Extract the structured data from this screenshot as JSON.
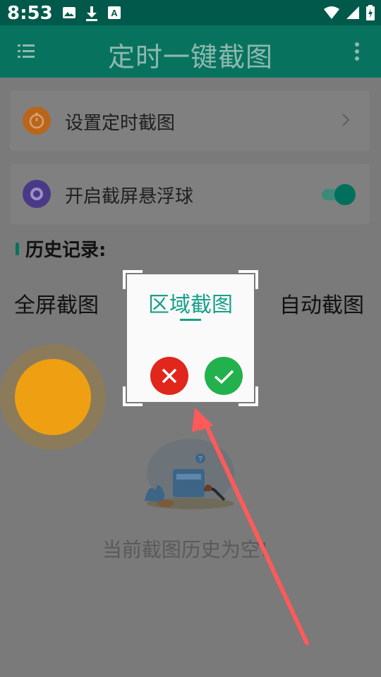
{
  "status_bar": {
    "time": "8:53",
    "left_icons": [
      "image-icon",
      "download-icon",
      "font-a-icon"
    ],
    "right_icons": [
      "wifi-icon",
      "cell-signal-icon",
      "battery-charging-icon"
    ]
  },
  "app_bar": {
    "title": "定时一键截图",
    "menu_icon": "menu-list-icon",
    "more_icon": "more-vert-icon"
  },
  "settings": {
    "timer_label": "设置定时截图",
    "timer_icon": "clock-icon",
    "timer_icon_color": "#b9661b",
    "float_label": "开启截屏悬浮球",
    "float_icon": "circle-target-icon",
    "float_icon_color": "#4a3a86",
    "float_toggle_on": true
  },
  "history": {
    "title": "历史记录:",
    "empty_text": "当前截图历史为空!"
  },
  "modes": {
    "full": "全屏截图",
    "auto": "自动截图"
  },
  "region_dialog": {
    "title": "区域截图",
    "cancel_icon": "close-icon",
    "confirm_icon": "check-icon"
  },
  "colors": {
    "accent": "#07735f",
    "float_ball": "#ef9f12",
    "cancel": "#e1261c",
    "confirm": "#22b14c",
    "arrow": "#ff5a5a"
  }
}
